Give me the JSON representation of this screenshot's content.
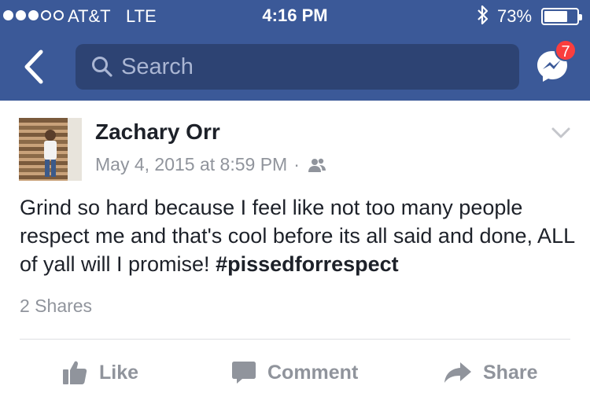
{
  "status_bar": {
    "carrier": "AT&T",
    "network": "LTE",
    "time": "4:16 PM",
    "battery_percent": "73%",
    "battery_level": 0.73,
    "signal_bars": 3,
    "signal_total": 5
  },
  "nav": {
    "back_icon": "chevron-left-icon",
    "search_placeholder": "Search",
    "messenger_icon": "messenger-icon",
    "messenger_badge": "7"
  },
  "post": {
    "author": "Zachary Orr",
    "date": "May 4, 2015 at 8:59 PM",
    "separator": "·",
    "audience_icon": "friends-icon",
    "text": "Grind so hard because I feel like not too many people respect me and that's cool before its all said and done, ALL of yall will I promise! ",
    "hashtag": "#pissedforrespect",
    "shares": "2 Shares"
  },
  "actions": {
    "like": "Like",
    "comment": "Comment",
    "share": "Share"
  },
  "colors": {
    "brand": "#3b5998",
    "search_bg": "#2d4373",
    "badge": "#fa3e3e",
    "muted_text": "#90949c"
  }
}
